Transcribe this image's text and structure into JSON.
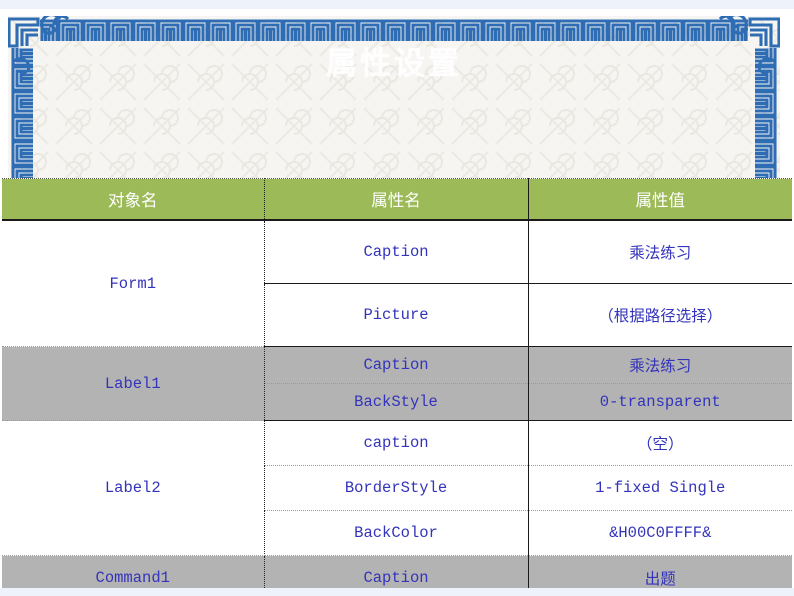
{
  "slide": {
    "title": "属性设置"
  },
  "table": {
    "headers": [
      "对象名",
      "属性名",
      "属性值"
    ],
    "rows": [
      {
        "object": "Form1",
        "properties": [
          {
            "name": "Caption",
            "value": "乘法练习",
            "value_lang": "cn"
          },
          {
            "name": "Picture",
            "value": "（根据路径选择）",
            "value_lang": "cn"
          }
        ]
      },
      {
        "object": "Label1",
        "properties": [
          {
            "name": "Caption",
            "value": "乘法练习",
            "value_lang": "cn"
          },
          {
            "name": "BackStyle",
            "value": "0-transparent",
            "value_lang": "en"
          }
        ]
      },
      {
        "object": "Label2",
        "properties": [
          {
            "name": "caption",
            "value": "（空）",
            "value_lang": "cn"
          },
          {
            "name": "BorderStyle",
            "value": "1-fixed Single",
            "value_lang": "en"
          },
          {
            "name": "BackColor",
            "value": "&H00C0FFFF&",
            "value_lang": "en"
          }
        ]
      },
      {
        "object": "Command1",
        "properties": [
          {
            "name": "Caption",
            "value": "出题",
            "value_lang": "cn"
          }
        ]
      }
    ]
  },
  "colors": {
    "header_green": "#9CBB58",
    "row_gray": "#B3B3B3",
    "text_blue": "#3333BB",
    "frame_blue": "#2E6DB4",
    "panel_bg": "#F7F5F2",
    "strip_blue": "#EEF3FB"
  }
}
